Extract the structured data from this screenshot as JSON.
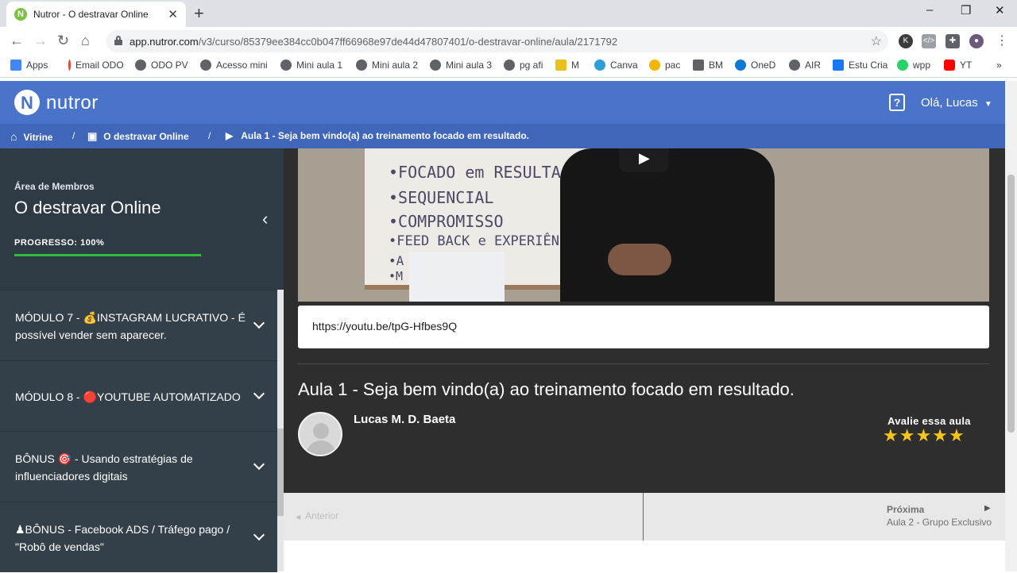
{
  "browser": {
    "tab_title": "Nutror - O destravar Online",
    "url_host": "app.nutror.com",
    "url_path": "/v3/curso/85379ee384cc0b047ff66968e97de44d47807401/o-destravar-online/aula/2171792",
    "bookmarks": [
      "Apps",
      "Email ODO",
      "ODO PV",
      "Acesso mini",
      "Mini aula 1",
      "Mini aula 2",
      "Mini aula 3",
      "pg afi",
      "M",
      "Canva",
      "pac",
      "BM",
      "OneD",
      "AIR",
      "Estu Cria",
      "wpp",
      "YT"
    ]
  },
  "header": {
    "logo": "nutror",
    "greeting": "Olá, Lucas"
  },
  "breadcrumb": {
    "home": "Vitrine",
    "course": "O destravar Online",
    "lesson": "Aula 1 - Seja bem vindo(a) ao treinamento focado em resultado."
  },
  "sidebar": {
    "subtitle": "Área de Membros",
    "title": "O destravar Online",
    "progress_label": "PROGRESSO: 100%",
    "progress": 1.0,
    "modules": [
      "MÓDULO 7 - 💰INSTAGRAM LUCRATIVO - É possível vender sem aparecer.",
      "MÓDULO 8 - 🔴YOUTUBE AUTOMATIZADO",
      "BÔNUS 🎯 - Usando estratégias de influenciadores digitais",
      "♟BÔNUS - Facebook ADS / Tráfego pago / \"Robô de vendas\""
    ]
  },
  "video": {
    "board_lines": [
      "•FOCADO em RESULTA",
      "•SEQUENCIAL",
      "•COMPROMISSO",
      "•FEED BACK e EXPERIÊNCIAS",
      "•A",
      "•M              QUEADOS"
    ]
  },
  "lesson": {
    "link": "https://youtu.be/tpG-Hfbes9Q",
    "title": "Aula 1 - Seja bem vindo(a) ao treinamento focado em resultado.",
    "author": "Lucas M. D. Baeta",
    "rate_label": "Avalie essa aula",
    "rating": 5
  },
  "pager": {
    "prev": "Anterior",
    "next": "Próxima",
    "next_sub": "Aula 2 - Grupo Exclusivo"
  }
}
